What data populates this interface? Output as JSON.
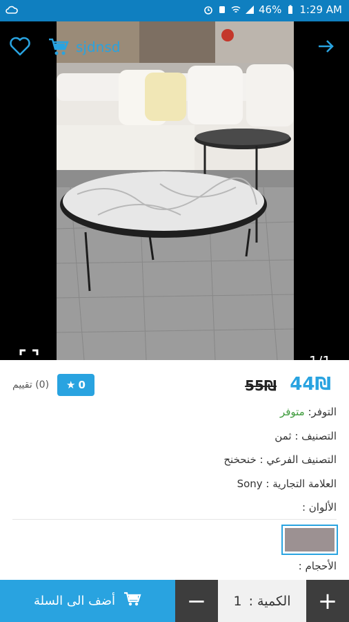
{
  "status_bar": {
    "battery": "46%",
    "time": "1:29 AM"
  },
  "header": {
    "store_name": "sjdnsd"
  },
  "gallery": {
    "pager": "1/1"
  },
  "product": {
    "price": "44₪",
    "old_price": "55₪",
    "rating_count": "0",
    "rating_text": "(0) تقييم",
    "availability_label": "التوفر:",
    "availability_value": "متوفر",
    "category": "التصنيف : ثمن",
    "subcategory": "التصنيف الفرعي : خنحخنح",
    "brand": "العلامة التجارية : Sony",
    "colors_label": "الألوان :",
    "sizes_label": "الأحجام :",
    "color_swatches": [
      "#9c9192"
    ]
  },
  "bottom_bar": {
    "add_to_cart": "أضف الى السلة",
    "minus": "−",
    "qty_label": "الكمية :",
    "qty_value": "1",
    "plus": "+"
  },
  "colors": {
    "accent": "#29a3e0",
    "status_bar": "#0f7fc0",
    "available": "#3c9a3a",
    "dark_button": "#3d3d3d"
  }
}
